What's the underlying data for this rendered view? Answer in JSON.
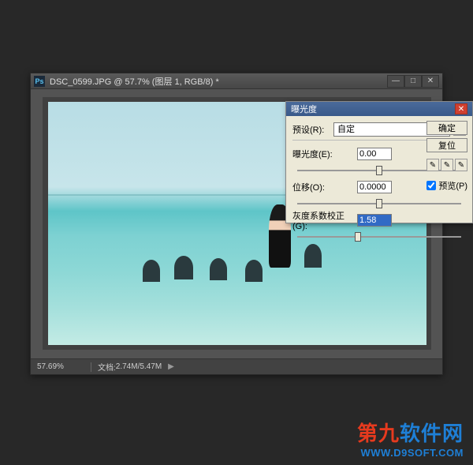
{
  "window": {
    "title": "DSC_0599.JPG @ 57.7% (图层 1, RGB/8) *"
  },
  "status": {
    "zoom": "57.69%",
    "doc_label": "文档:",
    "doc_size": "2.74M/5.47M"
  },
  "dialog": {
    "title": "曝光度",
    "preset_label": "预设(R):",
    "preset_value": "自定",
    "exposure_label": "曝光度(E):",
    "exposure_value": "0.00",
    "offset_label": "位移(O):",
    "offset_value": "0.0000",
    "gamma_label": "灰度系数校正(G):",
    "gamma_value": "1.58",
    "ok": "确定",
    "cancel": "复位",
    "preview": "预览(P)"
  },
  "watermark": {
    "text1": "第九",
    "text2": "软件网",
    "url": "WWW.D9SOFT.COM"
  }
}
